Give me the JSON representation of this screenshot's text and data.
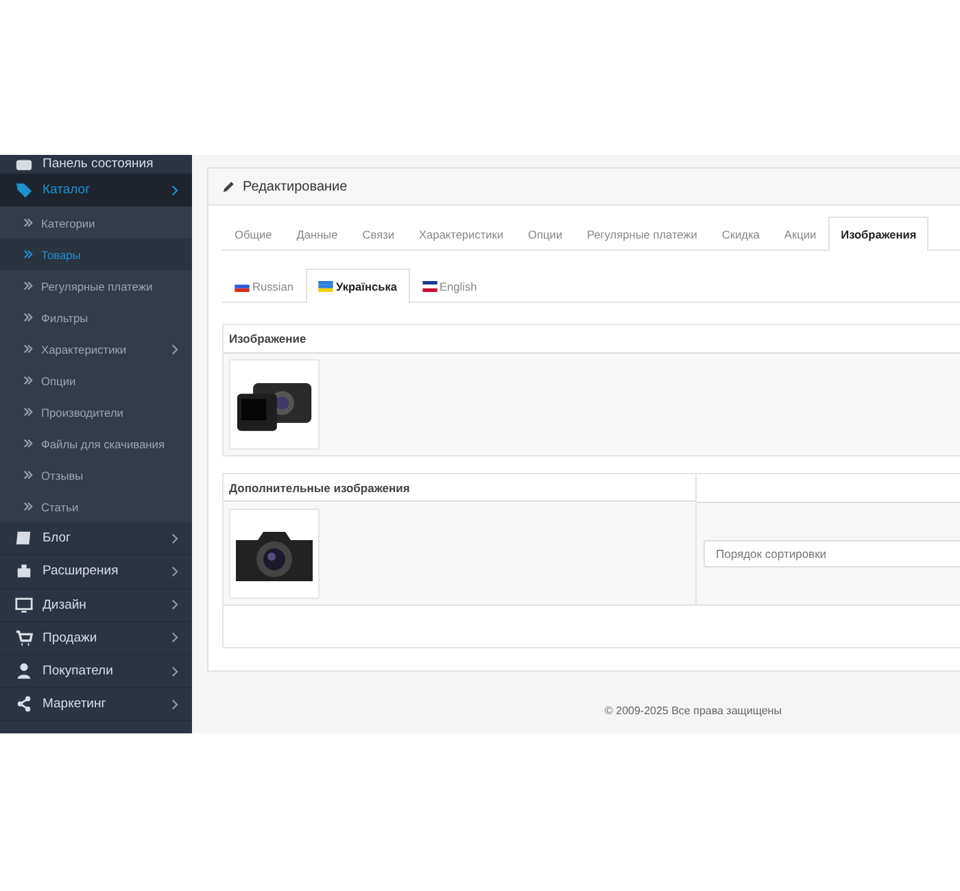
{
  "sidebar": {
    "items": [
      {
        "label": "Панель состояния",
        "has_children": false,
        "selected": false
      },
      {
        "label": "Каталог",
        "has_children": true,
        "selected": true,
        "children": [
          {
            "label": "Категории",
            "has_children": false,
            "selected": false
          },
          {
            "label": "Товары",
            "has_children": false,
            "selected": true
          },
          {
            "label": "Регулярные платежи",
            "has_children": false,
            "selected": false
          },
          {
            "label": "Фильтры",
            "has_children": false,
            "selected": false
          },
          {
            "label": "Характеристики",
            "has_children": true,
            "selected": false
          },
          {
            "label": "Опции",
            "has_children": false,
            "selected": false
          },
          {
            "label": "Производители",
            "has_children": false,
            "selected": false
          },
          {
            "label": "Файлы для скачивания",
            "has_children": false,
            "selected": false
          },
          {
            "label": "Отзывы",
            "has_children": false,
            "selected": false
          },
          {
            "label": "Статьи",
            "has_children": false,
            "selected": false
          }
        ]
      },
      {
        "label": "Блог",
        "has_children": true,
        "selected": false
      },
      {
        "label": "Расширения",
        "has_children": true,
        "selected": false
      },
      {
        "label": "Дизайн",
        "has_children": true,
        "selected": false
      },
      {
        "label": "Продажи",
        "has_children": true,
        "selected": false
      },
      {
        "label": "Покупатели",
        "has_children": true,
        "selected": false
      },
      {
        "label": "Маркетинг",
        "has_children": true,
        "selected": false
      }
    ]
  },
  "panel": {
    "title": "Редактирование",
    "tabs": [
      {
        "label": "Общие",
        "selected": false
      },
      {
        "label": "Данные",
        "selected": false
      },
      {
        "label": "Связи",
        "selected": false
      },
      {
        "label": "Характеристики",
        "selected": false
      },
      {
        "label": "Опции",
        "selected": false
      },
      {
        "label": "Регулярные платежи",
        "selected": false
      },
      {
        "label": "Скидка",
        "selected": false
      },
      {
        "label": "Акции",
        "selected": false
      },
      {
        "label": "Изображения",
        "selected": true
      }
    ],
    "language_tabs": [
      {
        "label": "Russian",
        "selected": false
      },
      {
        "label": "Українська",
        "selected": true
      },
      {
        "label": "English",
        "selected": false
      }
    ],
    "image_table": {
      "heading": "Изображение"
    },
    "additional_images": {
      "heading": "Дополнительные изображения",
      "sort_order": {
        "placeholder": "Порядок сортировки"
      }
    }
  },
  "footer": {
    "text": "© 2009-2025 Все права защищены"
  }
}
